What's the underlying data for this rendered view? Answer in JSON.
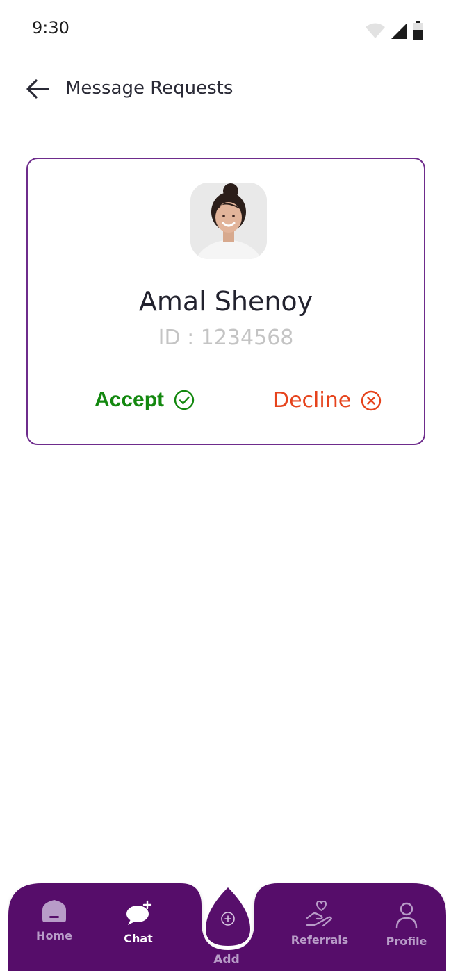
{
  "status_bar": {
    "time": "9:30"
  },
  "header": {
    "title": "Message Requests"
  },
  "request": {
    "name": "Amal Shenoy",
    "id_text": "ID : 1234568",
    "accept_label": "Accept",
    "decline_label": "Decline"
  },
  "bottom_nav": {
    "items": [
      {
        "label": "Home",
        "icon": "home-icon"
      },
      {
        "label": "Chat",
        "icon": "chat-icon"
      },
      {
        "label": "Add",
        "icon": "add-icon"
      },
      {
        "label": "Referrals",
        "icon": "referrals-icon"
      },
      {
        "label": "Profile",
        "icon": "profile-icon"
      }
    ],
    "active": "Chat"
  },
  "colors": {
    "brand_purple": "#570f6b",
    "card_border": "#6e2c8c",
    "accept_green": "#13880f",
    "decline_red": "#e6431c",
    "id_gray": "#c4c4c4"
  }
}
